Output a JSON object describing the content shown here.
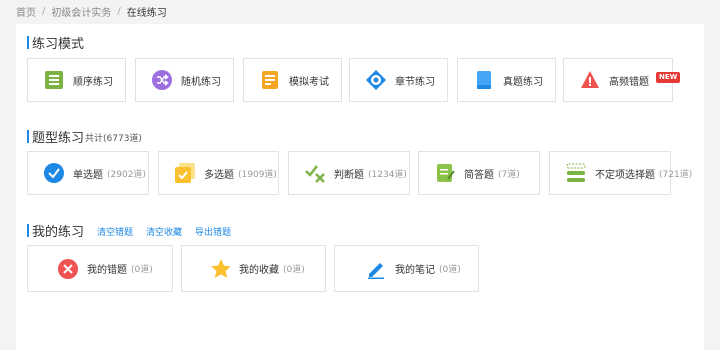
{
  "breadcrumb": {
    "home": "首页",
    "category": "初级会计实务",
    "current": "在线练习",
    "separator": "/"
  },
  "practice_modes": {
    "title": "练习模式",
    "items": [
      {
        "label": "顺序练习",
        "icon": "list-icon"
      },
      {
        "label": "随机练习",
        "icon": "shuffle-icon"
      },
      {
        "label": "模拟考试",
        "icon": "exam-icon"
      },
      {
        "label": "章节练习",
        "icon": "target-icon"
      },
      {
        "label": "真题练习",
        "icon": "book-icon"
      },
      {
        "label": "高频错题",
        "icon": "warning-icon",
        "badge": "NEW"
      }
    ]
  },
  "question_types": {
    "title": "题型练习",
    "total": "共计(6773道)",
    "items": [
      {
        "label": "单选题",
        "count": "(2902道)",
        "icon": "check-circle-icon"
      },
      {
        "label": "多选题",
        "count": "(1909道)",
        "icon": "multi-check-icon"
      },
      {
        "label": "判断题",
        "count": "(1234道)",
        "icon": "true-false-icon"
      },
      {
        "label": "简答题",
        "count": "(7道)",
        "icon": "notepad-icon"
      },
      {
        "label": "不定项选择题",
        "count": "(721道)",
        "icon": "options-icon"
      }
    ]
  },
  "my_practice": {
    "title": "我的练习",
    "links": [
      "清空错题",
      "清空收藏",
      "导出错题"
    ],
    "items": [
      {
        "label": "我的错题",
        "count": "(0道)",
        "icon": "error-icon"
      },
      {
        "label": "我的收藏",
        "count": "(0道)",
        "icon": "star-icon"
      },
      {
        "label": "我的笔记",
        "count": "(0道)",
        "icon": "pencil-icon"
      }
    ]
  },
  "colors": {
    "accent": "#1e88e5",
    "green": "#7cb342",
    "purple": "#9c6ee0",
    "orange": "#f5a623",
    "red": "#ef5350",
    "star": "#fbc02d"
  }
}
